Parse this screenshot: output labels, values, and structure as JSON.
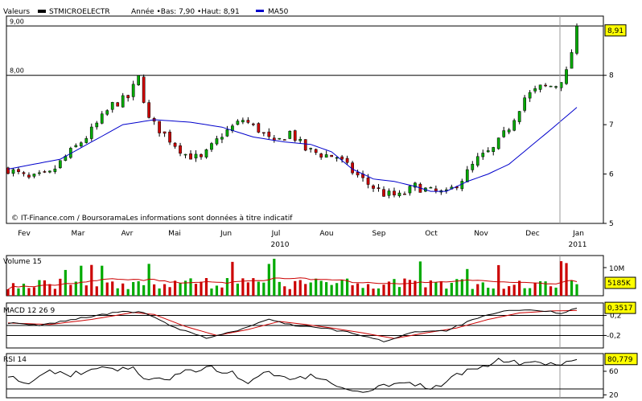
{
  "legend": {
    "prefix": "Valeurs",
    "security": "STMICROELECTR",
    "range_text": "Année •Bas: 7,90 •Haut: 8,91",
    "ma_label": "MA50"
  },
  "colors": {
    "up": "#00aa00",
    "down": "#cc0000",
    "ma": "#0000cc",
    "macd": "#000000",
    "signal": "#cc0000",
    "volume_ma": "#cc0000",
    "value_box": "#ffff00"
  },
  "copyright": "© IT-Finance.com / BoursoramaLes informations sont données à titre indicatif",
  "chart_data": [
    {
      "id": "price",
      "type": "candlestick",
      "title": "",
      "x_labels": [
        "Fev",
        "Mar",
        "Avr",
        "Mai",
        "Jun",
        "Jul",
        "Aou",
        "Sep",
        "Oct",
        "Nov",
        "Dec",
        "Jan"
      ],
      "year_labels": [
        "2010",
        "2011"
      ],
      "y_ticks": [
        5,
        6,
        7,
        8
      ],
      "y_range": [
        5,
        9.2
      ],
      "hlines": [
        {
          "value": 9.0,
          "label": "9,00"
        },
        {
          "value": 8.0,
          "label": "8,00"
        }
      ],
      "last_value_label": "8,91",
      "path_points": [
        [
          0,
          6.1
        ],
        [
          4,
          5.9
        ],
        [
          8,
          6.0
        ],
        [
          11,
          6.35
        ],
        [
          15,
          6.75
        ],
        [
          20,
          7.4
        ],
        [
          23,
          7.55
        ],
        [
          25,
          7.95
        ],
        [
          27,
          7.1
        ],
        [
          30,
          6.8
        ],
        [
          34,
          6.4
        ],
        [
          37,
          6.3
        ],
        [
          41,
          6.8
        ],
        [
          45,
          7.1
        ],
        [
          48,
          6.9
        ],
        [
          51,
          6.6
        ],
        [
          54,
          6.85
        ],
        [
          57,
          6.5
        ],
        [
          60,
          6.4
        ],
        [
          63,
          6.35
        ],
        [
          66,
          6.05
        ],
        [
          69,
          5.8
        ],
        [
          72,
          5.6
        ],
        [
          75,
          5.55
        ],
        [
          78,
          5.75
        ],
        [
          81,
          5.65
        ],
        [
          84,
          5.6
        ],
        [
          87,
          5.9
        ],
        [
          90,
          6.3
        ],
        [
          93,
          6.5
        ],
        [
          96,
          6.95
        ],
        [
          99,
          7.55
        ],
        [
          102,
          7.75
        ],
        [
          105,
          7.8
        ],
        [
          107,
          8.05
        ],
        [
          109,
          8.91
        ]
      ],
      "ma50_points": [
        [
          0,
          6.1
        ],
        [
          10,
          6.3
        ],
        [
          16,
          6.65
        ],
        [
          22,
          7.0
        ],
        [
          28,
          7.1
        ],
        [
          35,
          7.05
        ],
        [
          41,
          6.95
        ],
        [
          47,
          6.75
        ],
        [
          53,
          6.65
        ],
        [
          58,
          6.6
        ],
        [
          62,
          6.45
        ],
        [
          66,
          6.1
        ],
        [
          70,
          5.9
        ],
        [
          74,
          5.85
        ],
        [
          78,
          5.75
        ],
        [
          81,
          5.65
        ],
        [
          84,
          5.65
        ],
        [
          88,
          5.85
        ],
        [
          92,
          6.0
        ],
        [
          96,
          6.2
        ],
        [
          100,
          6.55
        ],
        [
          104,
          6.9
        ],
        [
          109,
          7.35
        ]
      ]
    },
    {
      "id": "volume",
      "type": "bar",
      "title": "Volume 15",
      "y_ticks": [
        "10M"
      ],
      "last_value_label": "5185K",
      "count": 110
    },
    {
      "id": "macd",
      "type": "line",
      "title": "MACD 12 26 9",
      "y_ticks": [
        "0,2",
        "-0,2"
      ],
      "last_value_label": "0,3517",
      "macd_points": [
        [
          0,
          0.05
        ],
        [
          6,
          0.0
        ],
        [
          14,
          0.15
        ],
        [
          22,
          0.28
        ],
        [
          26,
          0.26
        ],
        [
          32,
          -0.05
        ],
        [
          38,
          -0.25
        ],
        [
          44,
          -0.1
        ],
        [
          50,
          0.12
        ],
        [
          55,
          0.0
        ],
        [
          60,
          -0.05
        ],
        [
          66,
          -0.15
        ],
        [
          72,
          -0.32
        ],
        [
          78,
          -0.12
        ],
        [
          84,
          -0.1
        ],
        [
          90,
          0.15
        ],
        [
          96,
          0.3
        ],
        [
          102,
          0.3
        ],
        [
          106,
          0.25
        ],
        [
          109,
          0.35
        ]
      ],
      "signal_points": [
        [
          0,
          0.05
        ],
        [
          8,
          0.02
        ],
        [
          16,
          0.12
        ],
        [
          24,
          0.26
        ],
        [
          28,
          0.22
        ],
        [
          34,
          -0.02
        ],
        [
          40,
          -0.2
        ],
        [
          46,
          -0.08
        ],
        [
          52,
          0.08
        ],
        [
          57,
          0.02
        ],
        [
          62,
          -0.05
        ],
        [
          68,
          -0.15
        ],
        [
          74,
          -0.26
        ],
        [
          80,
          -0.15
        ],
        [
          86,
          -0.05
        ],
        [
          92,
          0.12
        ],
        [
          98,
          0.25
        ],
        [
          104,
          0.29
        ],
        [
          109,
          0.3
        ]
      ]
    },
    {
      "id": "rsi",
      "type": "line",
      "title": "RSI 14",
      "y_ticks": [
        "60",
        "20"
      ],
      "last_value_label": "80,779",
      "points": [
        [
          0,
          55
        ],
        [
          4,
          40
        ],
        [
          8,
          60
        ],
        [
          12,
          52
        ],
        [
          16,
          66
        ],
        [
          20,
          62
        ],
        [
          24,
          70
        ],
        [
          26,
          50
        ],
        [
          30,
          42
        ],
        [
          34,
          58
        ],
        [
          38,
          68
        ],
        [
          42,
          60
        ],
        [
          46,
          44
        ],
        [
          50,
          58
        ],
        [
          54,
          46
        ],
        [
          58,
          52
        ],
        [
          62,
          40
        ],
        [
          66,
          30
        ],
        [
          70,
          28
        ],
        [
          74,
          42
        ],
        [
          78,
          36
        ],
        [
          82,
          32
        ],
        [
          86,
          52
        ],
        [
          90,
          66
        ],
        [
          94,
          80
        ],
        [
          98,
          72
        ],
        [
          102,
          76
        ],
        [
          106,
          68
        ],
        [
          108,
          78
        ],
        [
          109,
          80.8
        ]
      ]
    }
  ]
}
